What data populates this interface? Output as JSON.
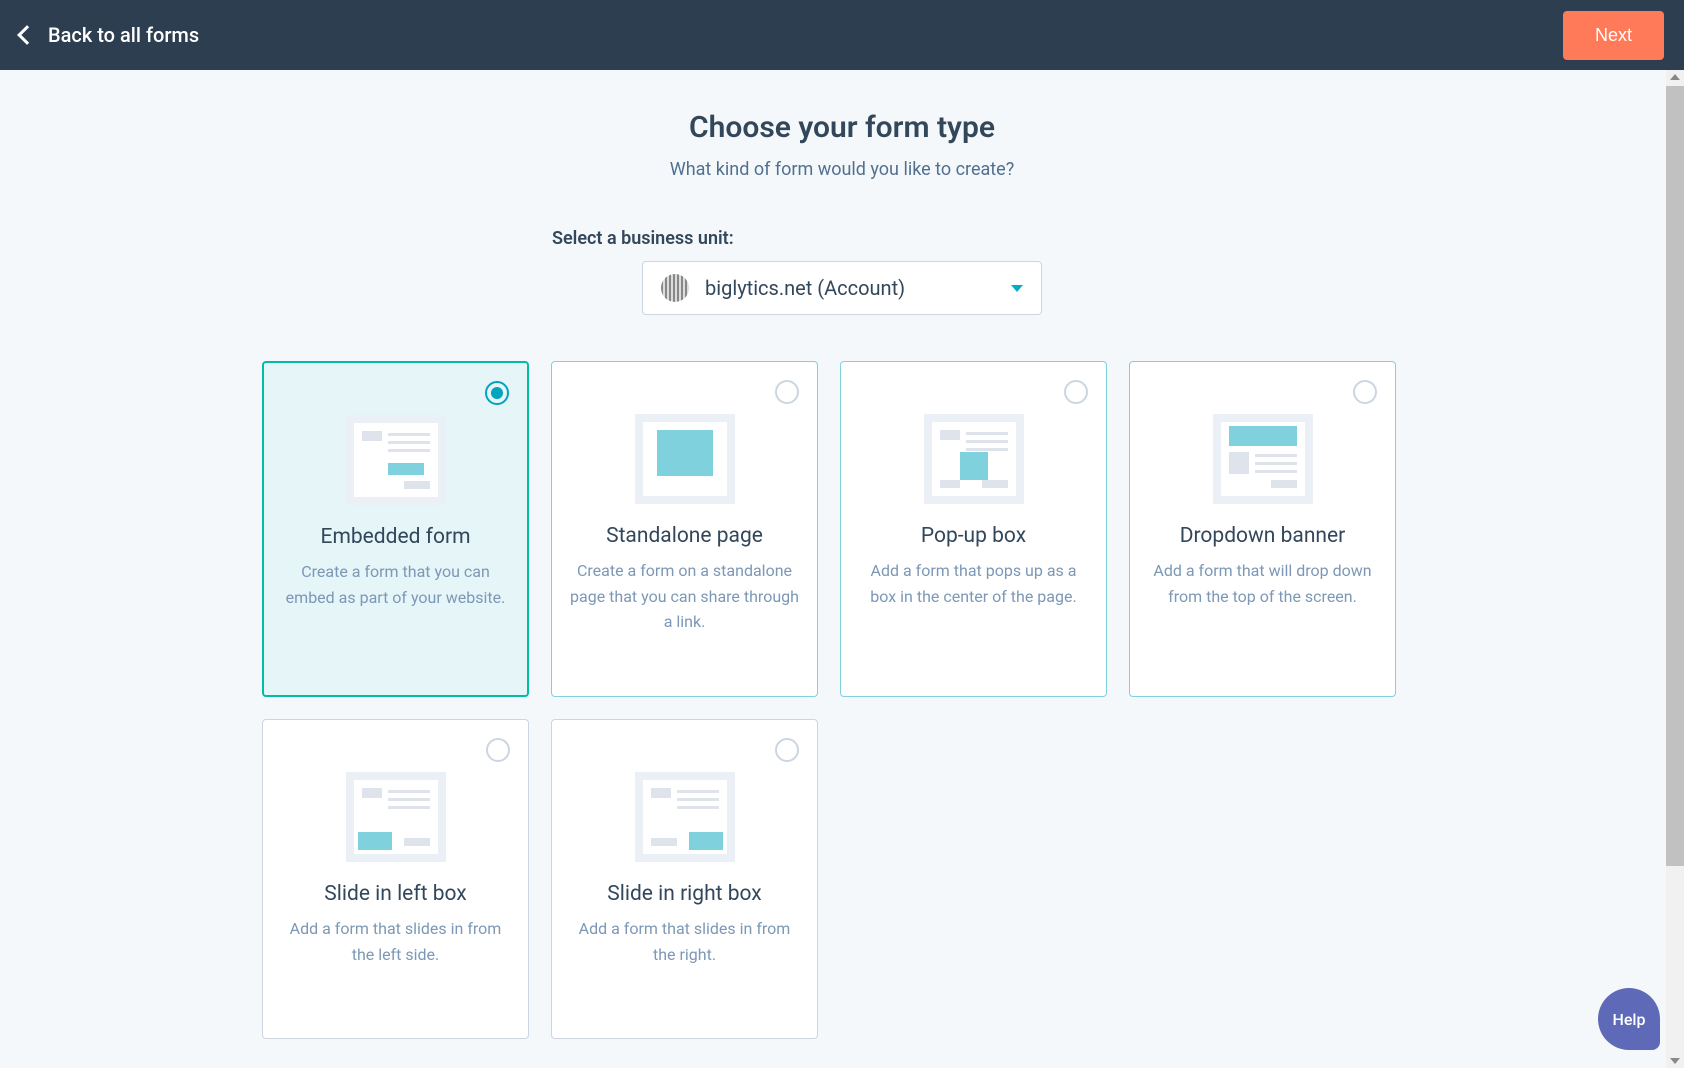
{
  "header": {
    "back_label": "Back to all forms",
    "next_label": "Next"
  },
  "page": {
    "title": "Choose your form type",
    "subtitle": "What kind of form would you like to create?"
  },
  "business_unit": {
    "label": "Select a business unit:",
    "selected": "biglytics.net (Account)"
  },
  "help": {
    "label": "Help"
  },
  "form_types": [
    {
      "id": "embedded",
      "title": "Embedded form",
      "description": "Create a form that you can embed as part of your website.",
      "selected": true
    },
    {
      "id": "standalone",
      "title": "Standalone page",
      "description": "Create a form on a standalone page that you can share through a link.",
      "selected": false
    },
    {
      "id": "popup",
      "title": "Pop-up box",
      "description": "Add a form that pops up as a box in the center of the page.",
      "selected": false
    },
    {
      "id": "dropdown",
      "title": "Dropdown banner",
      "description": "Add a form that will drop down from the top of the screen.",
      "selected": false
    },
    {
      "id": "slideleft",
      "title": "Slide in left box",
      "description": "Add a form that slides in from the left side.",
      "selected": false
    },
    {
      "id": "slideright",
      "title": "Slide in right box",
      "description": "Add a form that slides in from the right.",
      "selected": false
    }
  ]
}
